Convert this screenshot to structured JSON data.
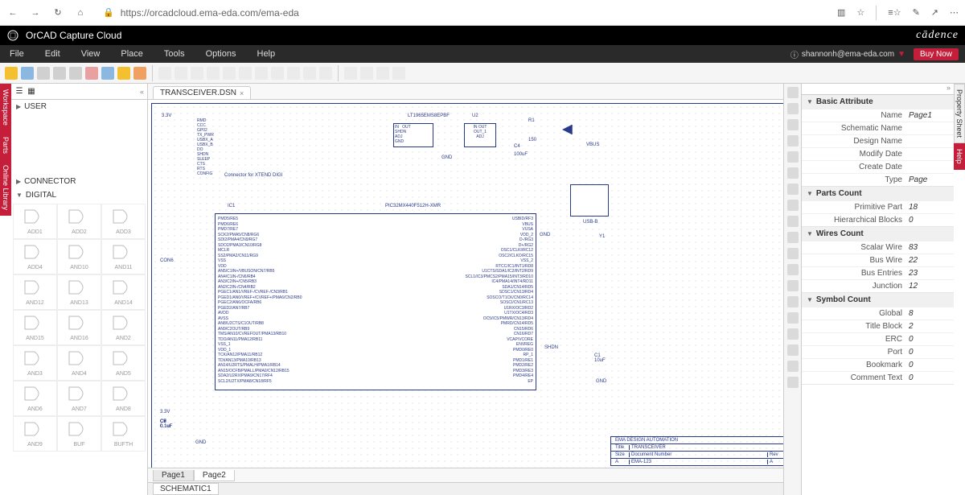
{
  "browser": {
    "url": "https://orcadcloud.ema-eda.com/ema-eda"
  },
  "app": {
    "title": "OrCAD Capture Cloud",
    "brand": "cādence"
  },
  "menu": {
    "items": [
      "File",
      "Edit",
      "View",
      "Place",
      "Tools",
      "Options",
      "Help"
    ],
    "user": "shannonh@ema-eda.com",
    "buy": "Buy Now"
  },
  "side_left": [
    "Workspace",
    "Parts",
    "Online Library"
  ],
  "side_right": [
    "Property Sheet",
    "Help"
  ],
  "tree": {
    "user": "USER",
    "connector": "CONNECTOR",
    "digital": "DIGITAL"
  },
  "parts": [
    "ADD1",
    "ADD2",
    "ADD3",
    "ADD4",
    "AND10",
    "AND11",
    "AND12",
    "AND13",
    "AND14",
    "AND15",
    "AND16",
    "AND2",
    "AND3",
    "AND4",
    "AND5",
    "AND6",
    "AND7",
    "AND8",
    "AND9",
    "BUF",
    "BUFTH"
  ],
  "doc": {
    "tab": "TRANSCEIVER.DSN",
    "pages": [
      "Page1",
      "Page2"
    ],
    "schematic": "SCHEMATIC1"
  },
  "schematic": {
    "u1": "LT1965EMS8EPBF",
    "u2": "U2",
    "ic1": "IC1",
    "ic1_part": "PIC32MX440F512H-XMR",
    "conn_label": "Connector for XTEND DIGI",
    "y1": "Y1",
    "r1": "R1",
    "r1_val": "150",
    "c4": "C4",
    "c4_val": "100uF",
    "v33": "3.3V",
    "gnd": "GND",
    "shdn": "SHDN",
    "vbus": "VBUS",
    "usb": "USB-B",
    "con6": "CON6",
    "title_block": {
      "company": "EMA DESIGN AUTOMATION",
      "title": "TRANSCEIVER",
      "doc_label": "Document Number",
      "doc": "EMA-123",
      "size": "A",
      "rev_label": "Rev",
      "rev": "A",
      "size_label": "Size",
      "title_label": "Title"
    },
    "pins_left": [
      "RMD",
      "CCC",
      "GP02",
      "TX_PWR",
      "USBX_A",
      "USBX_B",
      "DO",
      "SHDN",
      "SLEEP",
      "CTS",
      "RTS",
      "CONFIG"
    ],
    "ic_pins_left": [
      "PMD5/RE5",
      "PMD6/RE6",
      "PMD7/RE7",
      "SCK2/PMA5/CN8/RG6",
      "SDI2/PMA4/CN9/RG7",
      "SDO2/PMA3/CN10/RG8",
      "MCLR",
      "SS2/PMA2/CN11/RG9",
      "VSS",
      "VDD",
      "AN5/C1IN+/VBUSON/CN7/RB5",
      "AN4/C1IN-/CN6/RB4",
      "AN3/C2IN+/CN5/RB3",
      "AN2/C2IN-/CN4/RB2",
      "PGEC1/AN1/VREF-/CVREF-/CN3/RB1",
      "PGED1/AN0/VREF+/CVREF+/PMA6/CN2/RB0",
      "PGEC2/AN6/OCFA/RB6",
      "PGED2/AN7/RB7",
      "AVDD",
      "AVSS",
      "AN8/U2CTS/C1OUT/RB8",
      "AN9/C2OUT/RB9",
      "TMS/AN10/CVREFOUT/PMA13/RB10",
      "TDO/AN11/PMA12/RB11",
      "VSS_1",
      "VDD_1",
      "TCK/AN12/PMA11/RB12",
      "TDI/AN13/PMA10/RB13",
      "AN14/U2RTS/PMALH/PMA1/RB14",
      "AN15/OCFB/PMALL/PMA0/CN12/RB15",
      "SDA2/U2RX/PMA9/CN17/RF4",
      "SCL2/U2TX/PMA8/CN18/RF5"
    ],
    "ic_pins_right": [
      "USBID/RF3",
      "VBUS",
      "VUSA",
      "VDD_2",
      "D-/RG3",
      "D+/RG2",
      "OSC1/CLKI/RC12",
      "OSC2/CLKO/RC15",
      "VSS_2",
      "RTCC/IC1/INT1/RD8",
      "U1CTS/SDA1/IC2/INT2/RD9",
      "SCL1/IC3/PMCS2/PMA15/INT3/RD10",
      "IC4/PMA14/INT4/RD11",
      "SDA1/CN14/RD5",
      "SDSC1/CN13/RD4",
      "SOSCO/T1CK/CN0/RC14",
      "SOSCI/CN1/RC13",
      "U1RX/OC3/RD2",
      "U1TX/OC4/RD3",
      "OC5/IC5/PMWR/CN13/RD4",
      "PMRD/CN14/RD5",
      "CN15/RD6",
      "CN16/RD7",
      "VCAP/VCORE",
      "ENVREG",
      "PMD0/RE0",
      "RP_1",
      "PMD1/RE1",
      "PMD2/RE2",
      "PMD3/RE3",
      "PMD4/RE4",
      "EP"
    ]
  },
  "props": {
    "sections": [
      {
        "title": "Basic Attribute",
        "rows": [
          {
            "label": "Name",
            "value": "Page1"
          },
          {
            "label": "Schematic Name",
            "value": ""
          },
          {
            "label": "Design Name",
            "value": ""
          },
          {
            "label": "Modify Date",
            "value": ""
          },
          {
            "label": "Create Date",
            "value": ""
          },
          {
            "label": "Type",
            "value": "Page"
          }
        ]
      },
      {
        "title": "Parts Count",
        "rows": [
          {
            "label": "Primitive Part",
            "value": "18"
          },
          {
            "label": "Hierarchical Blocks",
            "value": "0"
          }
        ]
      },
      {
        "title": "Wires Count",
        "rows": [
          {
            "label": "Scalar Wire",
            "value": "83"
          },
          {
            "label": "Bus Wire",
            "value": "22"
          },
          {
            "label": "Bus Entries",
            "value": "23"
          },
          {
            "label": "Junction",
            "value": "12"
          }
        ]
      },
      {
        "title": "Symbol Count",
        "rows": [
          {
            "label": "Global",
            "value": "8"
          },
          {
            "label": "Title Block",
            "value": "2"
          },
          {
            "label": "ERC",
            "value": "0"
          },
          {
            "label": "Port",
            "value": "0"
          },
          {
            "label": "Bookmark",
            "value": "0"
          },
          {
            "label": "Comment Text",
            "value": "0"
          }
        ]
      }
    ]
  }
}
